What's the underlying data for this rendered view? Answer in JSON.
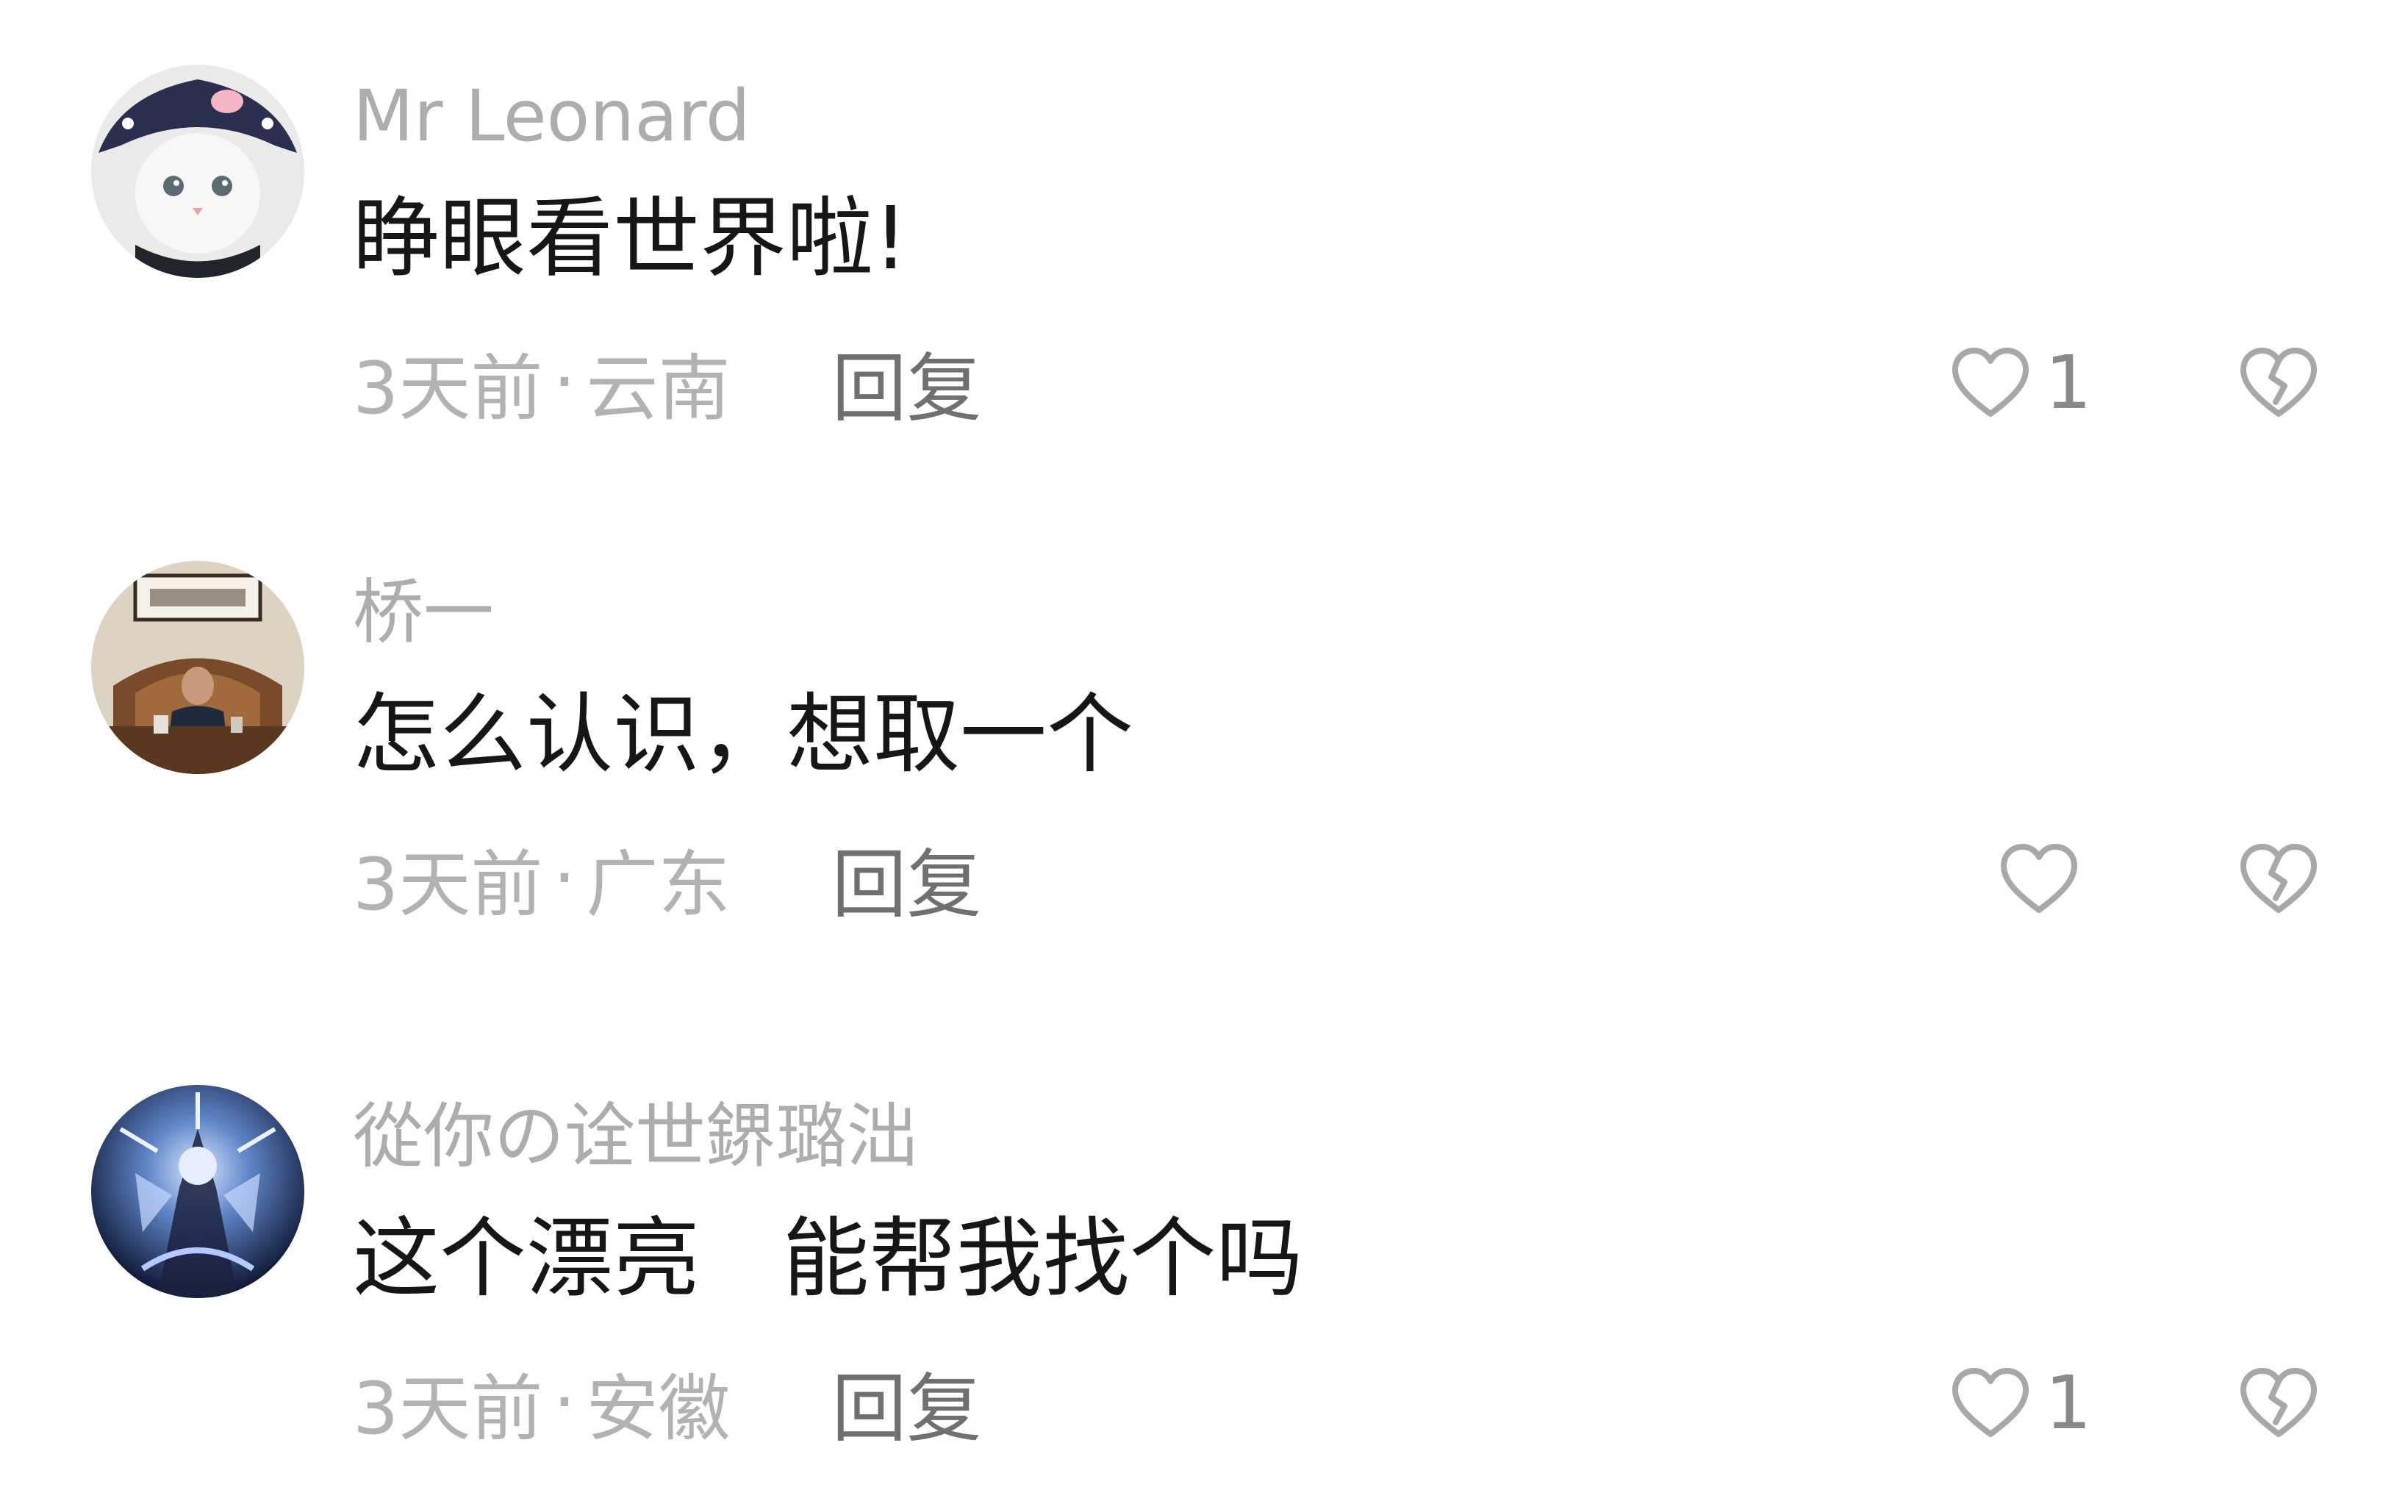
{
  "comments": [
    {
      "avatar_icon": "cat-avatar",
      "username": "Mr Leonard",
      "text": "睁眼看世界啦!",
      "time": "3天前",
      "separator": "·",
      "location": "云南",
      "reply_label": "回复",
      "like_count": "1"
    },
    {
      "avatar_icon": "office-photo-avatar",
      "username": "桥一",
      "text": "怎么认识，想取一个",
      "time": "3天前",
      "separator": "·",
      "location": "广东",
      "reply_label": "回复",
      "like_count": ""
    },
    {
      "avatar_icon": "anime-character-avatar",
      "username": "從你の诠世鎅璐泏",
      "text": "这个漂亮   能帮我找个吗",
      "time": "3天前",
      "separator": "·",
      "location": "安徽",
      "reply_label": "回复",
      "like_count": "1"
    }
  ],
  "icons": {
    "like": "heart-outline-icon",
    "dislike": "broken-heart-icon"
  },
  "colors": {
    "username": "#adadad",
    "text": "#161616",
    "meta": "#b2b2b2",
    "reply": "#707070",
    "icon": "#a8a8a8"
  }
}
